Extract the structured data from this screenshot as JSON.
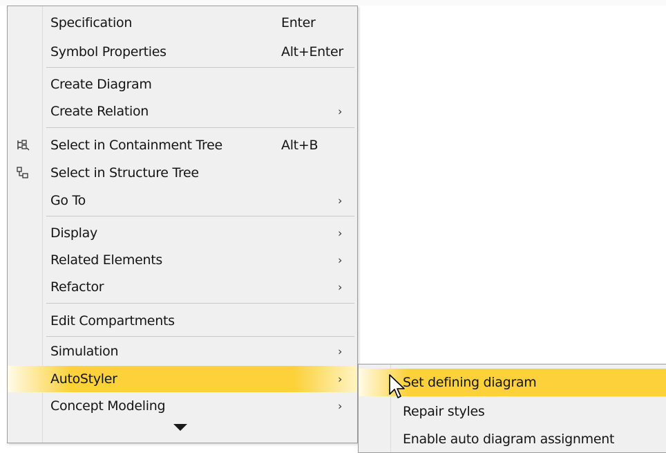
{
  "context_menu": {
    "items": [
      {
        "label": "Specification",
        "shortcut": "Enter"
      },
      {
        "label": "Symbol Properties",
        "shortcut": "Alt+Enter"
      },
      {
        "label": "Create Diagram"
      },
      {
        "label": "Create Relation",
        "submenu_arrow": "›"
      },
      {
        "label": "Select in Containment Tree",
        "shortcut": "Alt+B",
        "icon": "containment-tree-icon"
      },
      {
        "label": "Select in Structure Tree",
        "icon": "structure-tree-icon"
      },
      {
        "label": "Go To",
        "submenu_arrow": "›"
      },
      {
        "label": "Display",
        "submenu_arrow": "›"
      },
      {
        "label": "Related Elements",
        "submenu_arrow": "›"
      },
      {
        "label": "Refactor",
        "submenu_arrow": "›"
      },
      {
        "label": "Edit Compartments"
      },
      {
        "label": "Simulation",
        "submenu_arrow": "›"
      },
      {
        "label": "AutoStyler",
        "submenu_arrow": "›",
        "highlighted": true
      },
      {
        "label": "Concept Modeling",
        "submenu_arrow": "›"
      }
    ],
    "more_indicator": "scroll-down-arrow-icon"
  },
  "autostyler_submenu": {
    "items": [
      {
        "label": "Set defining diagram",
        "highlighted": true
      },
      {
        "label": "Repair styles"
      },
      {
        "label": "Enable auto diagram assignment"
      }
    ]
  },
  "colors": {
    "highlight": "#fcd13a",
    "menu_background": "#f0f0f0",
    "border": "#9b9b9b"
  }
}
